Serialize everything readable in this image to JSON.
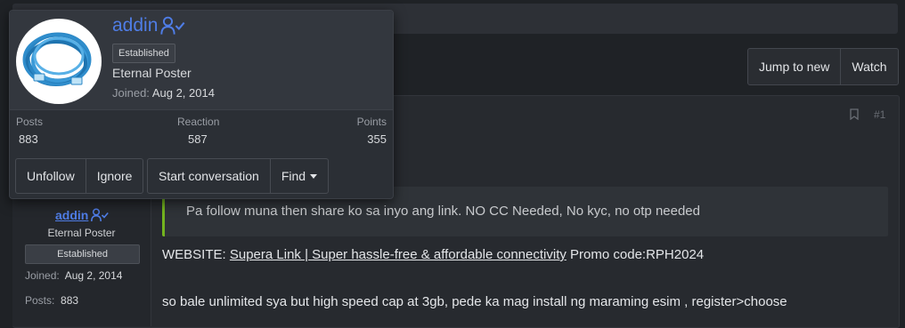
{
  "header": {
    "jump_to_new": "Jump to new",
    "watch": "Watch"
  },
  "post": {
    "number": "#1",
    "quote_text": "Pa follow muna then share ko sa inyo ang link. NO CC Needed, No kyc, no otp needed",
    "website_label": "WEBSITE:",
    "website_link_text": "Supera Link | Super hassle-free & affordable connectivity",
    "promo_text": "Promo code:RPH2024",
    "body_line": "so bale unlimited sya but high speed cap at 3gb, pede ka mag install ng maraming esim , register>choose"
  },
  "user_sidebar": {
    "username": "addin",
    "title": "Eternal Poster",
    "badge": "Established",
    "joined_label": "Joined:",
    "joined_value": "Aug 2, 2014",
    "posts_label": "Posts:",
    "posts_value": "883"
  },
  "popup": {
    "username": "addin",
    "badge": "Established",
    "title": "Eternal Poster",
    "joined_label": "Joined:",
    "joined_value": "Aug 2, 2014",
    "stats": {
      "posts_label": "Posts",
      "posts_value": "883",
      "reaction_label": "Reaction",
      "reaction_value": "587",
      "points_label": "Points",
      "points_value": "355"
    },
    "actions": {
      "unfollow": "Unfollow",
      "ignore": "Ignore",
      "start_conversation": "Start conversation",
      "find": "Find"
    }
  },
  "colors": {
    "accent": "#4f7de6",
    "quote_bar": "#73b41f",
    "background": "#1f2226"
  },
  "icons": {
    "verified": "user-check-icon",
    "bookmark": "bookmark-icon",
    "dropdown": "caret-down-icon"
  }
}
